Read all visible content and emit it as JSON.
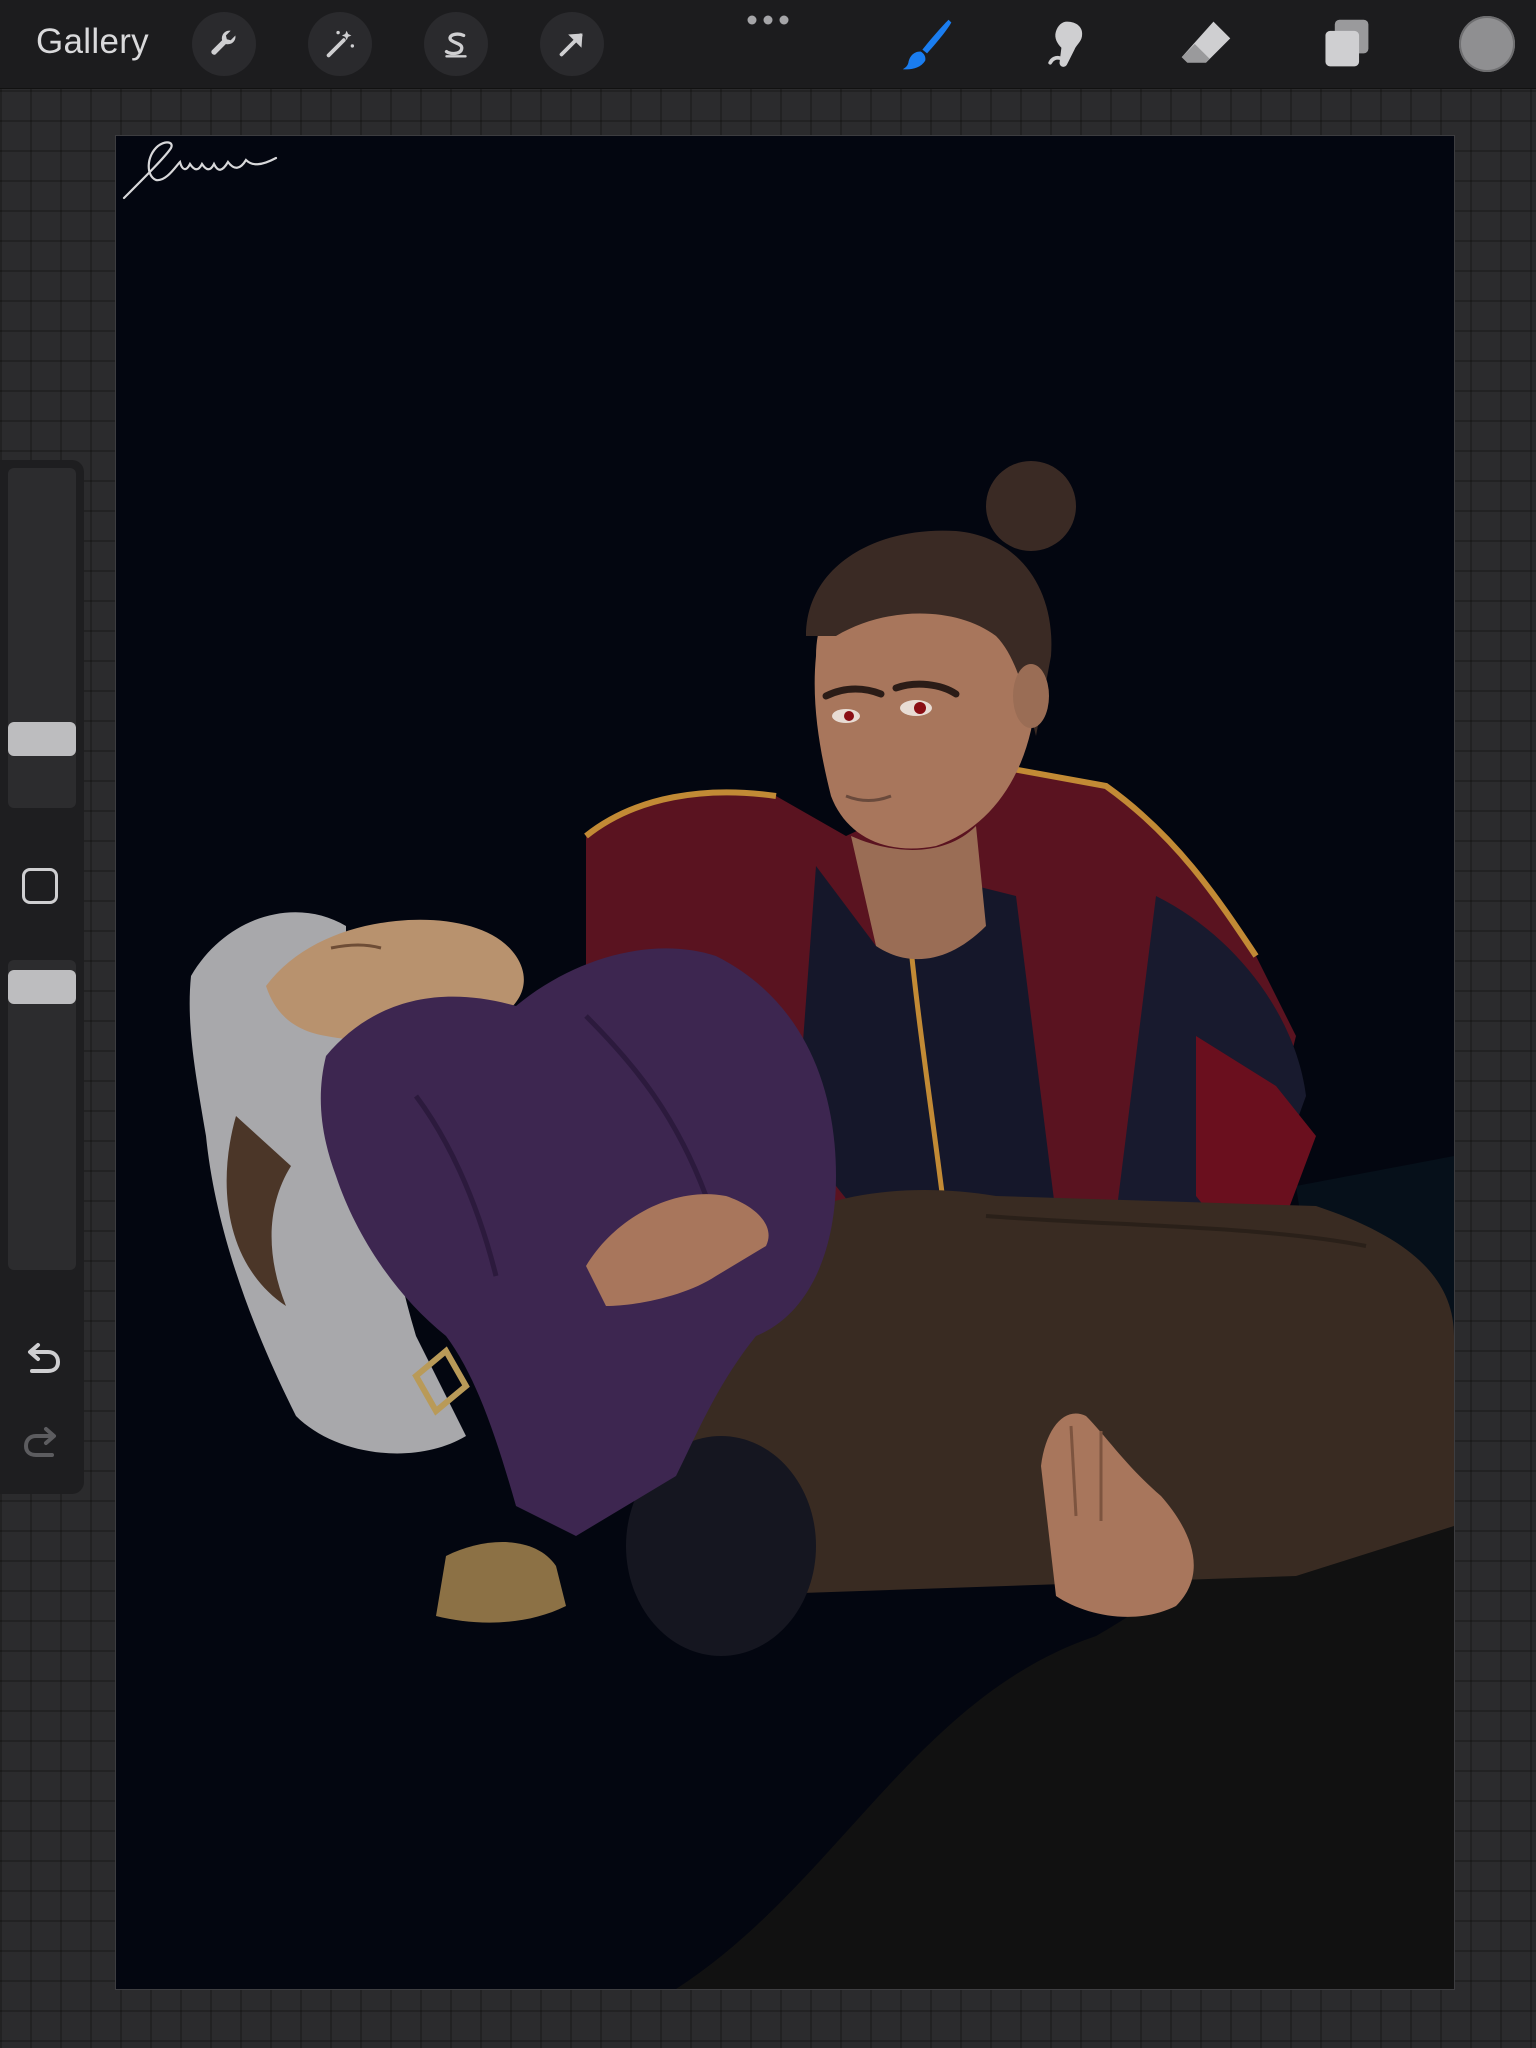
{
  "toolbar": {
    "gallery_label": "Gallery",
    "left_tools": [
      "wrench-icon",
      "magic-wand-icon",
      "selection-s-icon",
      "arrow-transform-icon"
    ],
    "more_icon": "ellipsis-icon",
    "right_tools": [
      "brush-icon",
      "smudge-icon",
      "eraser-icon",
      "layers-icon"
    ],
    "active_tool": "brush",
    "accent_color": "#1a7df0",
    "current_color": "#8f8f91"
  },
  "sidebar": {
    "brush_size_icon": "size-slider",
    "opacity_icon": "opacity-slider",
    "modify_icon": "square-icon",
    "undo_icon": "undo-icon",
    "redo_icon": "redo-icon"
  },
  "canvas": {
    "artwork": "digital-painting",
    "background_color": "#030610"
  }
}
